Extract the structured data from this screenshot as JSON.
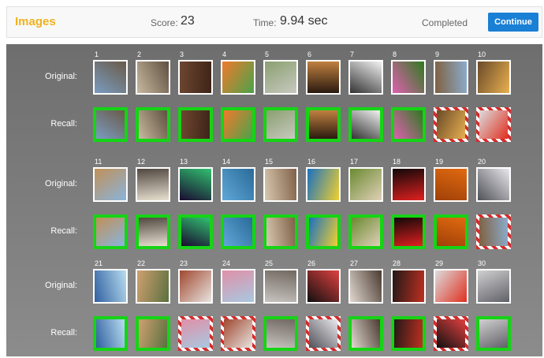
{
  "header": {
    "title": "Images",
    "score_label": "Score:",
    "score_value": "23",
    "time_label": "Time:",
    "time_value": "9.94 sec",
    "status": "Completed",
    "continue_label": "Continue"
  },
  "labels": {
    "original": "Original:",
    "recall": "Recall:"
  },
  "colors": {
    "title": "#f0b21e",
    "button": "#1a80d6",
    "correct": "#15d415",
    "wrong": "#d62b2b"
  },
  "images": [
    {
      "id": "1",
      "name": "harbor-boats",
      "c": [
        "#7a9cc0",
        "#6a5a48"
      ]
    },
    {
      "id": "2",
      "name": "wallaby",
      "c": [
        "#c9b9a0",
        "#5e5040"
      ]
    },
    {
      "id": "3",
      "name": "brick-wall",
      "c": [
        "#6e4630",
        "#3e2418"
      ]
    },
    {
      "id": "4",
      "name": "vegetables-plate",
      "c": [
        "#f07a2c",
        "#4aa34a"
      ]
    },
    {
      "id": "5",
      "name": "patio-sofa",
      "c": [
        "#8aa070",
        "#c8c8c0"
      ]
    },
    {
      "id": "6",
      "name": "sunset-field",
      "c": [
        "#c08040",
        "#2a1a10"
      ]
    },
    {
      "id": "7",
      "name": "smartphone",
      "c": [
        "#f2f2f2",
        "#333333"
      ]
    },
    {
      "id": "8",
      "name": "pink-flowers",
      "c": [
        "#2e7a20",
        "#e060b0"
      ]
    },
    {
      "id": "9",
      "name": "street-sunset",
      "c": [
        "#8aaccc",
        "#806040"
      ]
    },
    {
      "id": "10",
      "name": "desert-sun",
      "c": [
        "#e8b050",
        "#6a4a28"
      ]
    },
    {
      "id": "11",
      "name": "sphinx",
      "c": [
        "#8ab4dc",
        "#c09058"
      ]
    },
    {
      "id": "12",
      "name": "newspaper",
      "c": [
        "#e8e0d0",
        "#504840"
      ]
    },
    {
      "id": "13",
      "name": "aurora",
      "c": [
        "#1a0a30",
        "#30c070"
      ]
    },
    {
      "id": "14",
      "name": "sea-island",
      "c": [
        "#60a8d8",
        "#2a6a98"
      ]
    },
    {
      "id": "15",
      "name": "dry-plant",
      "c": [
        "#d8c8b0",
        "#806048"
      ]
    },
    {
      "id": "16",
      "name": "swimmer",
      "c": [
        "#1a70c0",
        "#f0d030"
      ]
    },
    {
      "id": "17",
      "name": "sleeping-dog",
      "c": [
        "#6a8a30",
        "#e0d0b8"
      ]
    },
    {
      "id": "18",
      "name": "red-light",
      "c": [
        "#100808",
        "#e02020"
      ]
    },
    {
      "id": "19",
      "name": "tangerines",
      "c": [
        "#e06a10",
        "#a04008"
      ]
    },
    {
      "id": "20",
      "name": "jumping-person",
      "c": [
        "#e8e8ec",
        "#505058"
      ]
    },
    {
      "id": "21",
      "name": "kite-streamers",
      "c": [
        "#b8dcf0",
        "#3060a0"
      ]
    },
    {
      "id": "22",
      "name": "cactus-flowers",
      "c": [
        "#5a7040",
        "#d0a070"
      ]
    },
    {
      "id": "23",
      "name": "tennis-net",
      "c": [
        "#e8e4e0",
        "#a04830"
      ]
    },
    {
      "id": "24",
      "name": "blossom-bokeh",
      "c": [
        "#a8c8e0",
        "#e090a8"
      ]
    },
    {
      "id": "25",
      "name": "spoon-closeup",
      "c": [
        "#c8c4c0",
        "#706860"
      ]
    },
    {
      "id": "26",
      "name": "spinning-top",
      "c": [
        "#101010",
        "#e04040"
      ]
    },
    {
      "id": "27",
      "name": "man-portrait",
      "c": [
        "#e0d8d0",
        "#4a3a30"
      ]
    },
    {
      "id": "28",
      "name": "dancers",
      "c": [
        "#201818",
        "#c03020"
      ]
    },
    {
      "id": "29",
      "name": "red-tomatoes",
      "c": [
        "#dcdcdc",
        "#e03020"
      ]
    },
    {
      "id": "30",
      "name": "knight-armor",
      "c": [
        "#d0d0d0",
        "#606068"
      ]
    }
  ],
  "blocks": [
    {
      "original": [
        "1",
        "2",
        "3",
        "4",
        "5",
        "6",
        "7",
        "8",
        "9",
        "10"
      ],
      "recall": [
        {
          "id": "1",
          "correct": true
        },
        {
          "id": "2",
          "correct": true
        },
        {
          "id": "3",
          "correct": true
        },
        {
          "id": "4",
          "correct": true
        },
        {
          "id": "5",
          "correct": true
        },
        {
          "id": "6",
          "correct": true
        },
        {
          "id": "7",
          "correct": true
        },
        {
          "id": "8",
          "correct": true
        },
        {
          "id": "10",
          "correct": false
        },
        {
          "id": "29",
          "correct": false
        }
      ]
    },
    {
      "original": [
        "11",
        "12",
        "13",
        "14",
        "15",
        "16",
        "17",
        "18",
        "19",
        "20"
      ],
      "recall": [
        {
          "id": "11",
          "correct": true
        },
        {
          "id": "12",
          "correct": true
        },
        {
          "id": "13",
          "correct": true
        },
        {
          "id": "14",
          "correct": true
        },
        {
          "id": "15",
          "correct": true
        },
        {
          "id": "16",
          "correct": true
        },
        {
          "id": "17",
          "correct": true
        },
        {
          "id": "18",
          "correct": true
        },
        {
          "id": "19",
          "correct": true
        },
        {
          "id": "9",
          "correct": false
        }
      ]
    },
    {
      "original": [
        "21",
        "22",
        "23",
        "24",
        "25",
        "26",
        "27",
        "28",
        "29",
        "30"
      ],
      "recall": [
        {
          "id": "21",
          "correct": true
        },
        {
          "id": "22",
          "correct": true
        },
        {
          "id": "24",
          "correct": false
        },
        {
          "id": "23",
          "correct": false
        },
        {
          "id": "25",
          "correct": true
        },
        {
          "id": "20",
          "correct": false
        },
        {
          "id": "27",
          "correct": true
        },
        {
          "id": "28",
          "correct": true
        },
        {
          "id": "26",
          "correct": false
        },
        {
          "id": "30",
          "correct": true
        }
      ]
    }
  ]
}
